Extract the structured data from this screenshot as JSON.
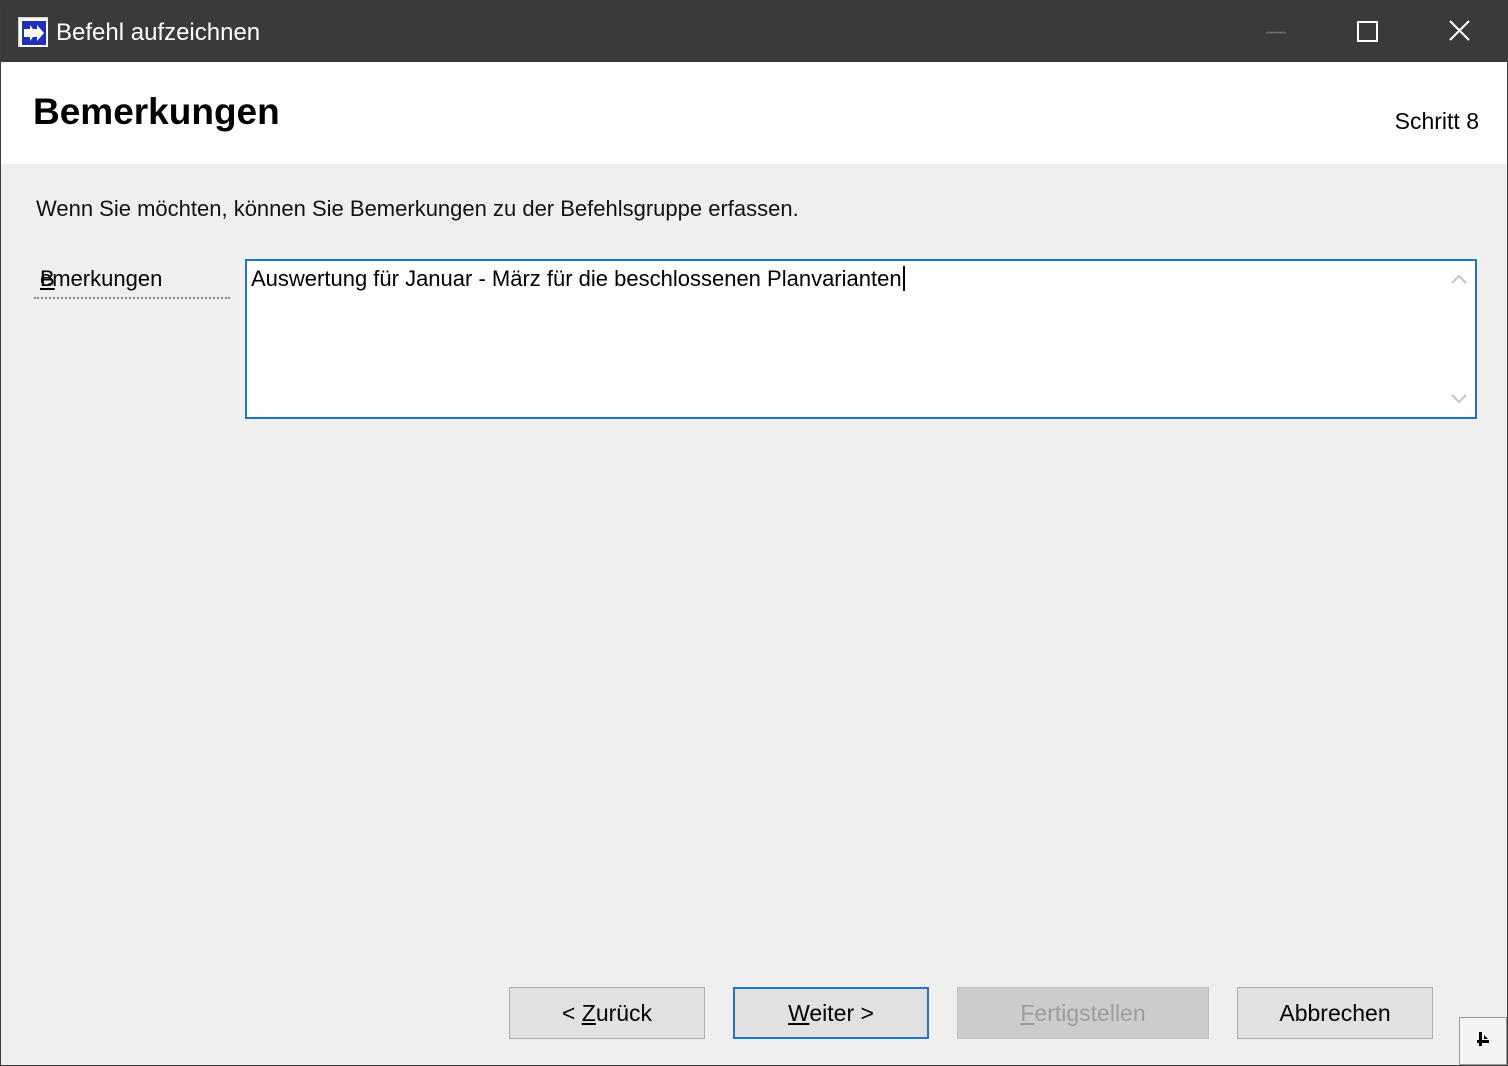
{
  "window": {
    "title": "Befehl aufzeichnen",
    "colors": {
      "titlebar": "#3a3a3a",
      "accent": "#1f73c8",
      "app_icon_blue": "#1f2fb8"
    }
  },
  "header": {
    "title": "Bemerkungen",
    "step": "Schritt 8"
  },
  "body": {
    "instruction": "Wenn Sie möchten, können Sie Bemerkungen zu der Befehlsgruppe erfassen.",
    "remarks_field": {
      "label_mnemonic": "B",
      "label_rest": "emerkungen",
      "value": "Auswertung für Januar - März für die beschlossenen Planvarianten"
    }
  },
  "buttons": {
    "back": {
      "prefix": "< ",
      "mnemonic": "Z",
      "rest": "urück"
    },
    "next": {
      "mnemonic": "W",
      "rest": "eiter >"
    },
    "finish": {
      "mnemonic": "F",
      "rest": "ertigstellen",
      "enabled": false
    },
    "cancel": {
      "label": "Abbrechen"
    }
  },
  "icons": {
    "app": "double-arrow-icon",
    "minimize": "minimize-icon",
    "maximize": "maximize-icon",
    "close": "close-icon",
    "scroll_up": "chevron-up-icon",
    "scroll_down": "chevron-down-icon",
    "help": "help-pointer-icon"
  }
}
